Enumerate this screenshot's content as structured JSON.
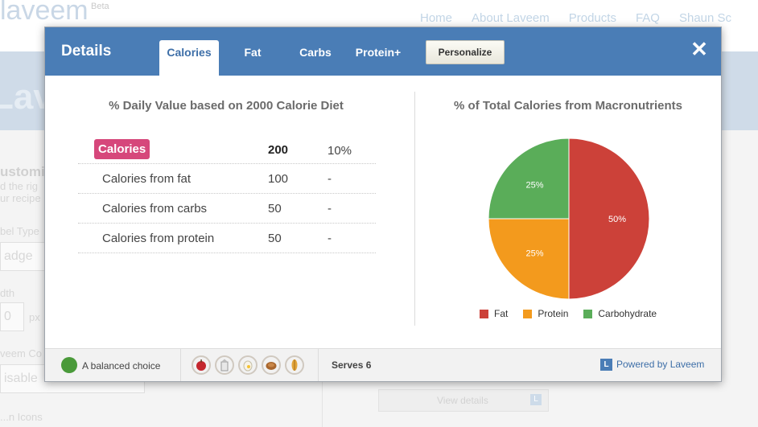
{
  "background": {
    "logo": "laveem",
    "beta": "Beta",
    "nav": [
      "Home",
      "About Laveem",
      "Products",
      "FAQ",
      "Shaun Sc"
    ],
    "banner_text": "Lave",
    "left_heading": "ustomi",
    "left_lines": [
      "d the rig",
      "ur recipe"
    ],
    "label_type_label": "bel Type",
    "label_type_value": "adge",
    "width_label": "dth",
    "width_value": "0",
    "width_unit": "px",
    "color_label": "veem Co",
    "color_value": "isable",
    "icons_label": "...n Icons",
    "view_details": "View details",
    "view_details_logo": "L"
  },
  "modal": {
    "title": "Details",
    "tabs": [
      "Calories",
      "Fat",
      "Carbs",
      "Protein+"
    ],
    "active_tab": "Calories",
    "personalize_label": "Personalize",
    "close_symbol": "✕"
  },
  "daily_value": {
    "title": "% Daily Value based on 2000 Calorie Diet",
    "rows": [
      {
        "label": "Calories",
        "amount": "200",
        "percent": "10%"
      },
      {
        "label": "Calories from fat",
        "amount": "100",
        "percent": "-"
      },
      {
        "label": "Calories from carbs",
        "amount": "50",
        "percent": "-"
      },
      {
        "label": "Calories from protein",
        "amount": "50",
        "percent": "-"
      }
    ]
  },
  "chart_data": {
    "type": "pie",
    "title": "% of Total Calories from Macronutrients",
    "categories": [
      "Fat",
      "Protein",
      "Carbohydrate"
    ],
    "values": [
      50,
      25,
      25
    ],
    "labels": [
      "50%",
      "25%",
      "25%"
    ],
    "colors": [
      "#cc4139",
      "#f39a1d",
      "#5aad59"
    ],
    "legend": "bottom"
  },
  "footer": {
    "balance_label": "A balanced choice",
    "balance_color": "#4a9a3a",
    "food_icons": [
      "apple-icon",
      "milk-icon",
      "egg-icon",
      "meat-icon",
      "grain-icon"
    ],
    "serves_label": "Serves 6",
    "powered_logo": "L",
    "powered_label": "Powered by Laveem"
  }
}
